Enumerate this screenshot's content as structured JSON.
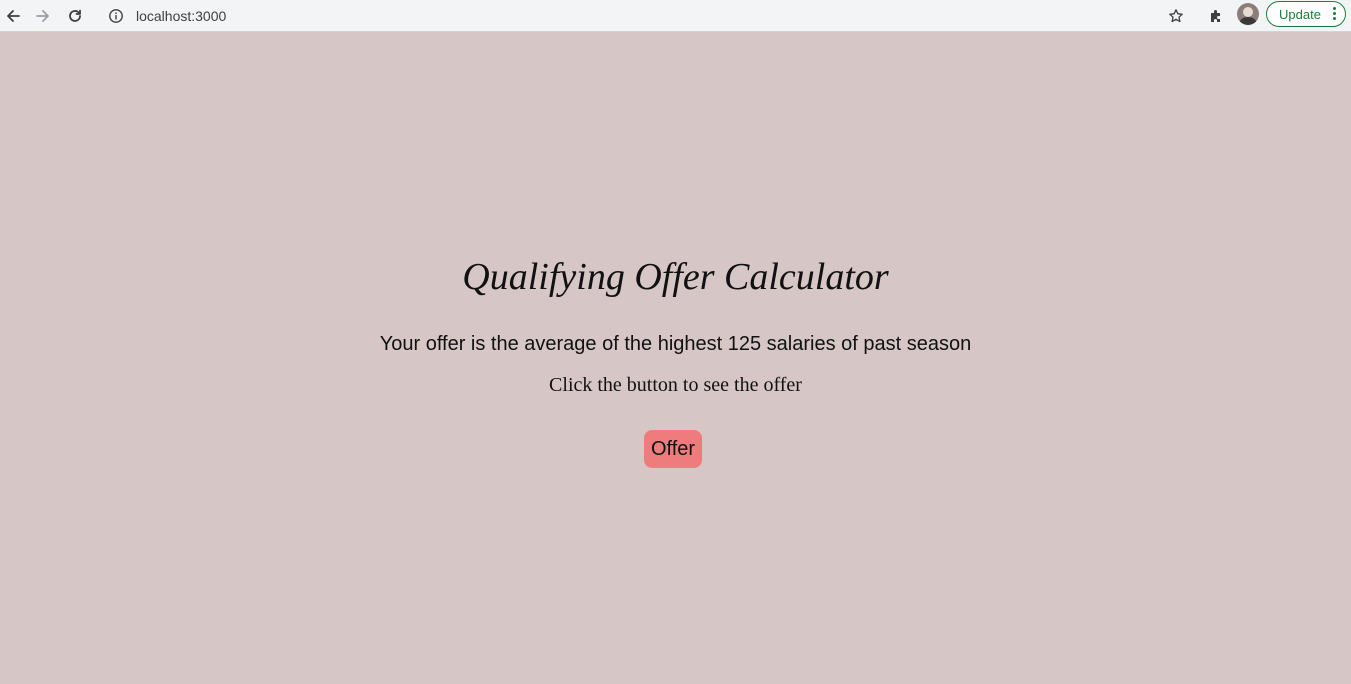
{
  "browser": {
    "url": "localhost:3000",
    "update_label": "Update",
    "icons": [
      "back-arrow-icon",
      "forward-arrow-icon",
      "reload-icon",
      "info-icon",
      "star-icon",
      "extensions-icon",
      "avatar",
      "menu-dots-icon"
    ]
  },
  "page": {
    "title": "Qualifying Offer Calculator",
    "subtitle": "Your offer is the average of the highest 125 salaries of past season",
    "hint": "Click the button to see the offer",
    "button_label": "Offer"
  },
  "colors": {
    "background": "#d7c6c6",
    "button": "#ee7c7c",
    "update_accent": "#188038"
  }
}
